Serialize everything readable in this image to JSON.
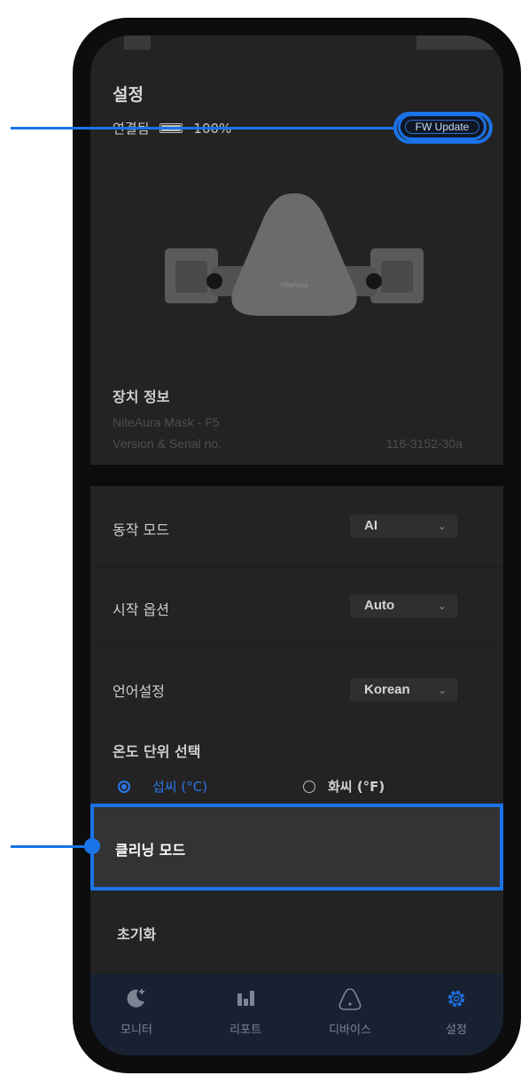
{
  "header": {
    "title": "설정",
    "connection_status": "연결됨",
    "battery": "100%",
    "fw_update_label": "FW Update"
  },
  "device_info": {
    "title": "장치 정보",
    "model": "NiteAura Mask - F5",
    "serial_label": "Version & Serial no.",
    "serial_value": "116-3152-30a",
    "brand_on_mask": "NiteAura"
  },
  "settings": {
    "operation_mode": {
      "label": "동작 모드",
      "value": "AI"
    },
    "start_option": {
      "label": "시작 옵션",
      "value": "Auto"
    },
    "language": {
      "label": "언어설정",
      "value": "Korean"
    },
    "temperature": {
      "title": "온도 단위 선택",
      "options": [
        {
          "label": "섭씨 (°C)",
          "selected": true
        },
        {
          "label": "화씨 (°F)",
          "selected": false
        }
      ]
    },
    "cleaning_mode": "클리닝 모드",
    "reset": "초기화"
  },
  "tabs": [
    {
      "label": "모니터",
      "icon": "moon-icon",
      "active": false
    },
    {
      "label": "리포트",
      "icon": "bar-chart-icon",
      "active": false
    },
    {
      "label": "디바이스",
      "icon": "device-icon",
      "active": false
    },
    {
      "label": "설정",
      "icon": "gear-icon",
      "active": true
    }
  ],
  "colors": {
    "accent": "#1a73e8",
    "background": "#232323",
    "tabbar": "#172131"
  }
}
